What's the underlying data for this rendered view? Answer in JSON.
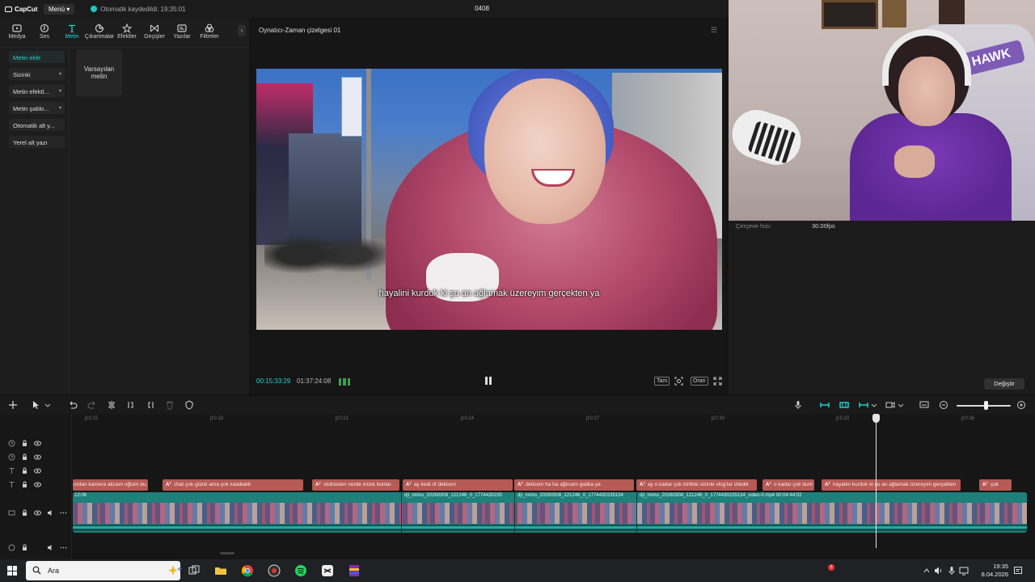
{
  "titlebar": {
    "app_name": "CapCut",
    "menu_label": "Menü",
    "autosave_text": "Otomatik kaydedildi: 19:35:01",
    "project_name": "0408"
  },
  "tools": [
    {
      "label": "Medya",
      "icon": "media-icon"
    },
    {
      "label": "Ses",
      "icon": "audio-icon"
    },
    {
      "label": "Metin",
      "icon": "text-icon",
      "active": true
    },
    {
      "label": "Çıkartmalar",
      "icon": "sticker-icon"
    },
    {
      "label": "Efektler",
      "icon": "effects-icon"
    },
    {
      "label": "Geçişler",
      "icon": "transitions-icon"
    },
    {
      "label": "Yazılar",
      "icon": "captions-icon"
    },
    {
      "label": "Filtreler",
      "icon": "filters-icon"
    }
  ],
  "text_categories": [
    {
      "label": "Metin ekle",
      "active": true,
      "dropdown": false
    },
    {
      "label": "Sizinki",
      "active": false,
      "dropdown": true
    },
    {
      "label": "Metin efektl...",
      "active": false,
      "dropdown": true
    },
    {
      "label": "Metin şablo...",
      "active": false,
      "dropdown": true
    },
    {
      "label": "Otomatik alt y...",
      "active": false,
      "dropdown": false
    },
    {
      "label": "Yerel alt yazı",
      "active": false,
      "dropdown": false
    }
  ],
  "preset": {
    "label": "Varsayılan metin"
  },
  "player": {
    "title": "Oynatıcı-Zaman çizelgesi 01",
    "subtitle": "hayalini kurduk ki şu an ağlamak üzereyim gerçekten ya",
    "current_time": "00:15:33:29",
    "total_time": "01:37:24:08",
    "full_label": "Tam",
    "ratio_label": "Oran"
  },
  "details": {
    "frame_rate_label": "Çerçeve hızı:",
    "frame_rate_value": "30.00fps",
    "change_button": "Değiştir"
  },
  "webcam": {
    "chair_logo": "HAWK"
  },
  "ruler_labels": [
    "10:15",
    "10:18",
    "10:21",
    "10:24",
    "10:27",
    "10:30",
    "15:33",
    "10:36"
  ],
  "text_clips": [
    {
      "text": "ordan kamera akcam oğlum bu"
    },
    {
      "text": "chat çok güzel ama çok kalabalık"
    },
    {
      "text": "otobüsten nerde incek bunlar"
    },
    {
      "text": "ay kedi of delicem"
    },
    {
      "text": "delicem ha ha ağlıcam galiba ya"
    },
    {
      "text": "ay o kadar çok birlikte sizinle vlog'lar izledik"
    },
    {
      "text": "o kadar çok bunl"
    },
    {
      "text": "hayalini kurduk ki şu an ağlamak üzereyim gerçekten"
    },
    {
      "text": "çok"
    }
  ],
  "text_clip_badge": "Aᵀ",
  "video_clips": [
    {
      "label": "12:06"
    },
    {
      "label": "dji_mimo_20260308_121246_0_1774430235"
    },
    {
      "label": "dji_mimo_20260308_121246_0_1774430235134"
    },
    {
      "label": "dji_mimo_20260308_121246_0_1774430235134_video-0.mp4   00:04:44:02"
    }
  ],
  "taskbar": {
    "search_placeholder": "Ara",
    "time": "19:35",
    "date": "8.04.2026",
    "notification_count": "3"
  }
}
